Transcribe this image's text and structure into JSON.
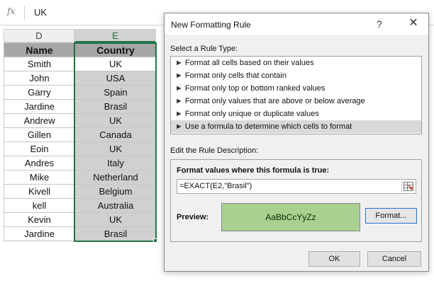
{
  "formula_bar": {
    "fx_label": "fx",
    "value": "UK"
  },
  "columns": {
    "d": "D",
    "e": "E"
  },
  "table": {
    "headers": [
      "Name",
      "Country"
    ],
    "rows": [
      [
        "Smith",
        "UK"
      ],
      [
        "John",
        "USA"
      ],
      [
        "Garry",
        "Spain"
      ],
      [
        "Jardine",
        "Brasil"
      ],
      [
        "Andrew",
        "UK"
      ],
      [
        "Gillen",
        "Canada"
      ],
      [
        "Eoin",
        "UK"
      ],
      [
        "Andres",
        "Italy"
      ],
      [
        "Mike",
        "Netherland"
      ],
      [
        "Kivell",
        "Belgium"
      ],
      [
        "kell",
        "Australia"
      ],
      [
        "Kevin",
        "UK"
      ],
      [
        "Jardine",
        "Brasil"
      ]
    ]
  },
  "dialog": {
    "title": "New Formatting Rule",
    "help": "?",
    "close": "✕",
    "rule_type_label": "Select a Rule Type:",
    "rule_types": [
      "Format all cells based on their values",
      "Format only cells that contain",
      "Format only top or bottom ranked values",
      "Format only values that are above or below average",
      "Format only unique or duplicate values",
      "Use a formula to determine which cells to format"
    ],
    "rule_arrow": "►",
    "selected_rule_index": 5,
    "description_label": "Edit the Rule Description:",
    "formula_prompt": "Format values where this formula is true:",
    "formula_value": "=EXACT(E2,\"Brasil\")",
    "preview_label": "Preview:",
    "preview_text": "AaBbCcYyZz",
    "format_button": "Format...",
    "ok_button": "OK",
    "cancel_button": "Cancel"
  },
  "colors": {
    "selection_green": "#217346",
    "preview_fill": "#a9d08e",
    "header_fill": "#a6a6a6",
    "selected_range_fill": "#d0d0d0"
  }
}
